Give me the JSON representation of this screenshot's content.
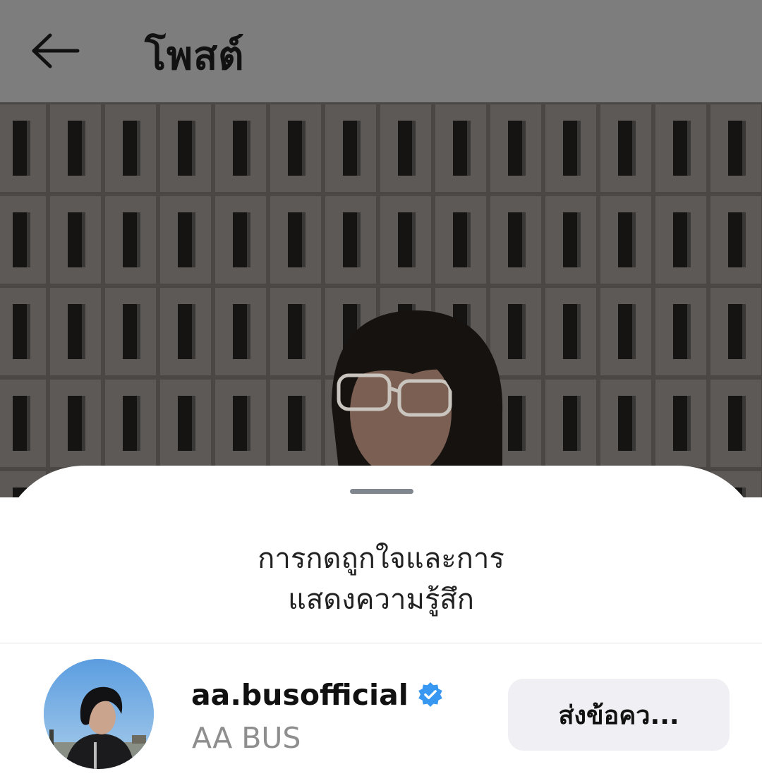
{
  "header": {
    "title": "โพสต์",
    "back_icon": "arrow-left-icon"
  },
  "sheet": {
    "title_line1": "การกดถูกใจและการ",
    "title_line2": "แสดงความรู้สึก"
  },
  "reactions": [
    {
      "username": "aa.busofficial",
      "verified": true,
      "full_name": "AA BUS",
      "action_label": "ส่งข้อคว..."
    }
  ],
  "colors": {
    "verified_blue": "#3897f0",
    "button_bg": "#efeff4",
    "overlay": "#7d7d7d"
  }
}
